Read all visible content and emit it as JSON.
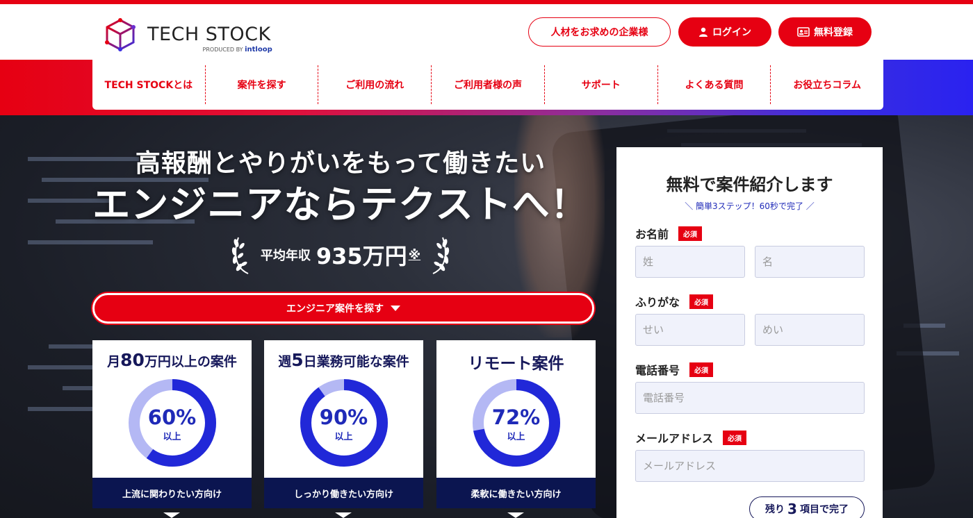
{
  "brand": {
    "name": "TECH STOCK",
    "produced_by": "PRODUCED BY",
    "produced_by_brand": "intloop",
    "accent": "#e60012",
    "navy": "#16185a"
  },
  "header": {
    "company_button": "人材をお求めの企業様",
    "login_button": "ログイン",
    "register_button": "無料登録"
  },
  "nav": [
    "TECH STOCKとは",
    "案件を探す",
    "ご利用の流れ",
    "ご利用者様の声",
    "サポート",
    "よくある質問",
    "お役立ちコラム"
  ],
  "hero": {
    "subtitle": "高報酬とやりがいをもって働きたい",
    "title": "エンジニアならテクストへ！",
    "salary_label": "平均年収",
    "salary_value": "935万円",
    "salary_note": "※",
    "search_button": "エンジニア案件を探す"
  },
  "stats": [
    {
      "title_pre": "月",
      "title_big": "80",
      "title_post": "万円以上の案件",
      "value": "60%",
      "unit": "以上",
      "fraction": 0.6,
      "footer": "上流に関わりたい方向け"
    },
    {
      "title_pre": "週",
      "title_big": "5",
      "title_post": "日業務可能な案件",
      "value": "90%",
      "unit": "以上",
      "fraction": 0.9,
      "footer": "しっかり働きたい方向け"
    },
    {
      "title_pre": "",
      "title_big": "",
      "title_post": "リモート案件",
      "value": "72%",
      "unit": "以上",
      "fraction": 0.72,
      "footer": "柔軟に働きたい方向け"
    }
  ],
  "form": {
    "title": "無料で案件紹介します",
    "subtitle": "＼ 簡単3ステップ！60秒で完了 ／",
    "required_badge": "必須",
    "name_label": "お名前",
    "last_name_placeholder": "姓",
    "first_name_placeholder": "名",
    "kana_label": "ふりがな",
    "last_kana_placeholder": "せい",
    "first_kana_placeholder": "めい",
    "phone_label": "電話番号",
    "phone_placeholder": "電話番号",
    "email_label": "メールアドレス",
    "email_placeholder": "メールアドレス",
    "remaining_pre": "残り",
    "remaining_count": "3",
    "remaining_post": "項目で完了"
  }
}
